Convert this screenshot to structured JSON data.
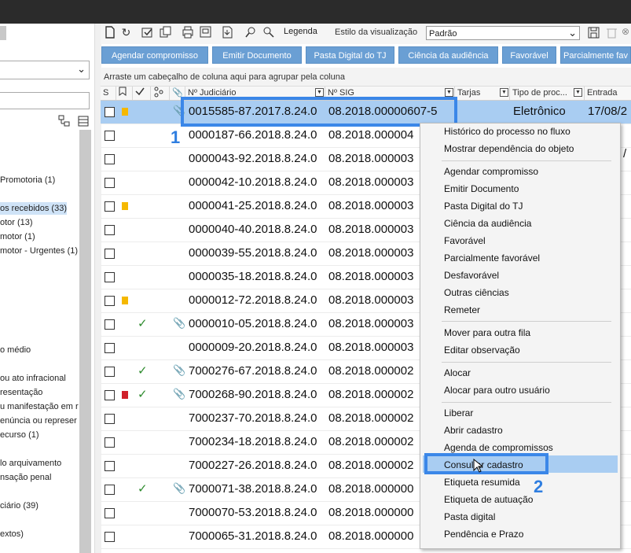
{
  "toolbar": {
    "legenda_label": "Legenda",
    "estilo_label": "Estilo da visualização",
    "estilo_value": "Padrão"
  },
  "actions": [
    {
      "label": "Agendar compromisso"
    },
    {
      "label": "Emitir Documento"
    },
    {
      "label": "Pasta Digital do TJ"
    },
    {
      "label": "Ciência da audiência"
    },
    {
      "label": "Favorável"
    },
    {
      "label": "Parcialmente fav"
    }
  ],
  "group_hint": "Arraste um cabeçalho de coluna aqui para agrupar pela coluna",
  "columns": {
    "s": "S",
    "nr_judiciario": "Nº Judiciário",
    "nr_sig": "Nº SIG",
    "tarjas": "Tarjas",
    "tipo": "Tipo de proc...",
    "entrada": "Entrada"
  },
  "left_tree": [
    {
      "label": "Promotoria (1)"
    },
    {
      "label": "os recebidos (33)"
    },
    {
      "label": "otor (13)"
    },
    {
      "label": "motor (1)"
    },
    {
      "label": "motor - Urgentes (1)"
    },
    {
      "label": "o médio"
    },
    {
      "label": "ou ato infracional"
    },
    {
      "label": "resentação"
    },
    {
      "label": "u manifestação em r"
    },
    {
      "label": "enúncia ou represer"
    },
    {
      "label": "ecurso (1)"
    },
    {
      "label": "lo arquivamento"
    },
    {
      "label": "nsação penal"
    },
    {
      "label": "ciário (39)"
    },
    {
      "label": "extos)"
    }
  ],
  "rows": [
    {
      "jud": "0015585-87.2017.8.24.0",
      "sig": "08.2018.00000607-5",
      "tipo": "Eletrônico",
      "entrada": "17/08/2"
    },
    {
      "jud": "0000187-66.2018.8.24.0",
      "sig": "08.2018.000004"
    },
    {
      "jud": "0000043-92.2018.8.24.0",
      "sig": "08.2018.000003"
    },
    {
      "jud": "0000042-10.2018.8.24.0",
      "sig": "08.2018.000003"
    },
    {
      "jud": "0000041-25.2018.8.24.0",
      "sig": "08.2018.000003"
    },
    {
      "jud": "0000040-40.2018.8.24.0",
      "sig": "08.2018.000003"
    },
    {
      "jud": "0000039-55.2018.8.24.0",
      "sig": "08.2018.000003"
    },
    {
      "jud": "0000035-18.2018.8.24.0",
      "sig": "08.2018.000003"
    },
    {
      "jud": "0000012-72.2018.8.24.0",
      "sig": "08.2018.000003"
    },
    {
      "jud": "0000010-05.2018.8.24.0",
      "sig": "08.2018.000003"
    },
    {
      "jud": "0000009-20.2018.8.24.0",
      "sig": "08.2018.000003"
    },
    {
      "jud": "7000276-67.2018.8.24.0",
      "sig": "08.2018.000002"
    },
    {
      "jud": "7000268-90.2018.8.24.0",
      "sig": "08.2018.000002"
    },
    {
      "jud": "7000237-70.2018.8.24.0",
      "sig": "08.2018.000002"
    },
    {
      "jud": "7000234-18.2018.8.24.0",
      "sig": "08.2018.000002"
    },
    {
      "jud": "7000227-26.2018.8.24.0",
      "sig": "08.2018.000002"
    },
    {
      "jud": "7000071-38.2018.8.24.0",
      "sig": "08.2018.000000"
    },
    {
      "jud": "7000070-53.2018.8.24.0",
      "sig": "08.2018.000000"
    },
    {
      "jud": "7000065-31.2018.8.24.0",
      "sig": "08.2018.000000"
    }
  ],
  "annotations": {
    "one": "1",
    "two": "2"
  },
  "context_menu": [
    {
      "label": "Histórico do processo no fluxo"
    },
    {
      "label": "Mostrar dependência do objeto"
    },
    {
      "label": "Agendar compromisso"
    },
    {
      "label": "Emitir Documento"
    },
    {
      "label": "Pasta Digital do TJ"
    },
    {
      "label": "Ciência da audiência"
    },
    {
      "label": "Favorável"
    },
    {
      "label": "Parcialmente favorável"
    },
    {
      "label": "Desfavorável"
    },
    {
      "label": "Outras ciências"
    },
    {
      "label": "Remeter"
    },
    {
      "label": "Mover para outra fila"
    },
    {
      "label": "Editar observação"
    },
    {
      "label": "Alocar"
    },
    {
      "label": "Alocar para outro usuário"
    },
    {
      "label": "Liberar"
    },
    {
      "label": "Abrir cadastro"
    },
    {
      "label": "Agenda de compromissos"
    },
    {
      "label": "Consultar cadastro"
    },
    {
      "label": "Etiqueta resumida"
    },
    {
      "label": "Etiqueta de autuação"
    },
    {
      "label": "Pasta digital"
    },
    {
      "label": "Pendência e Prazo"
    }
  ],
  "colors": {
    "accent": "#3b87e8",
    "button": "#6a9fd4",
    "selection": "#a9cdf2",
    "flag_yellow": "#f5b800",
    "flag_red": "#d0202a",
    "check_green": "#2e8b2e"
  }
}
